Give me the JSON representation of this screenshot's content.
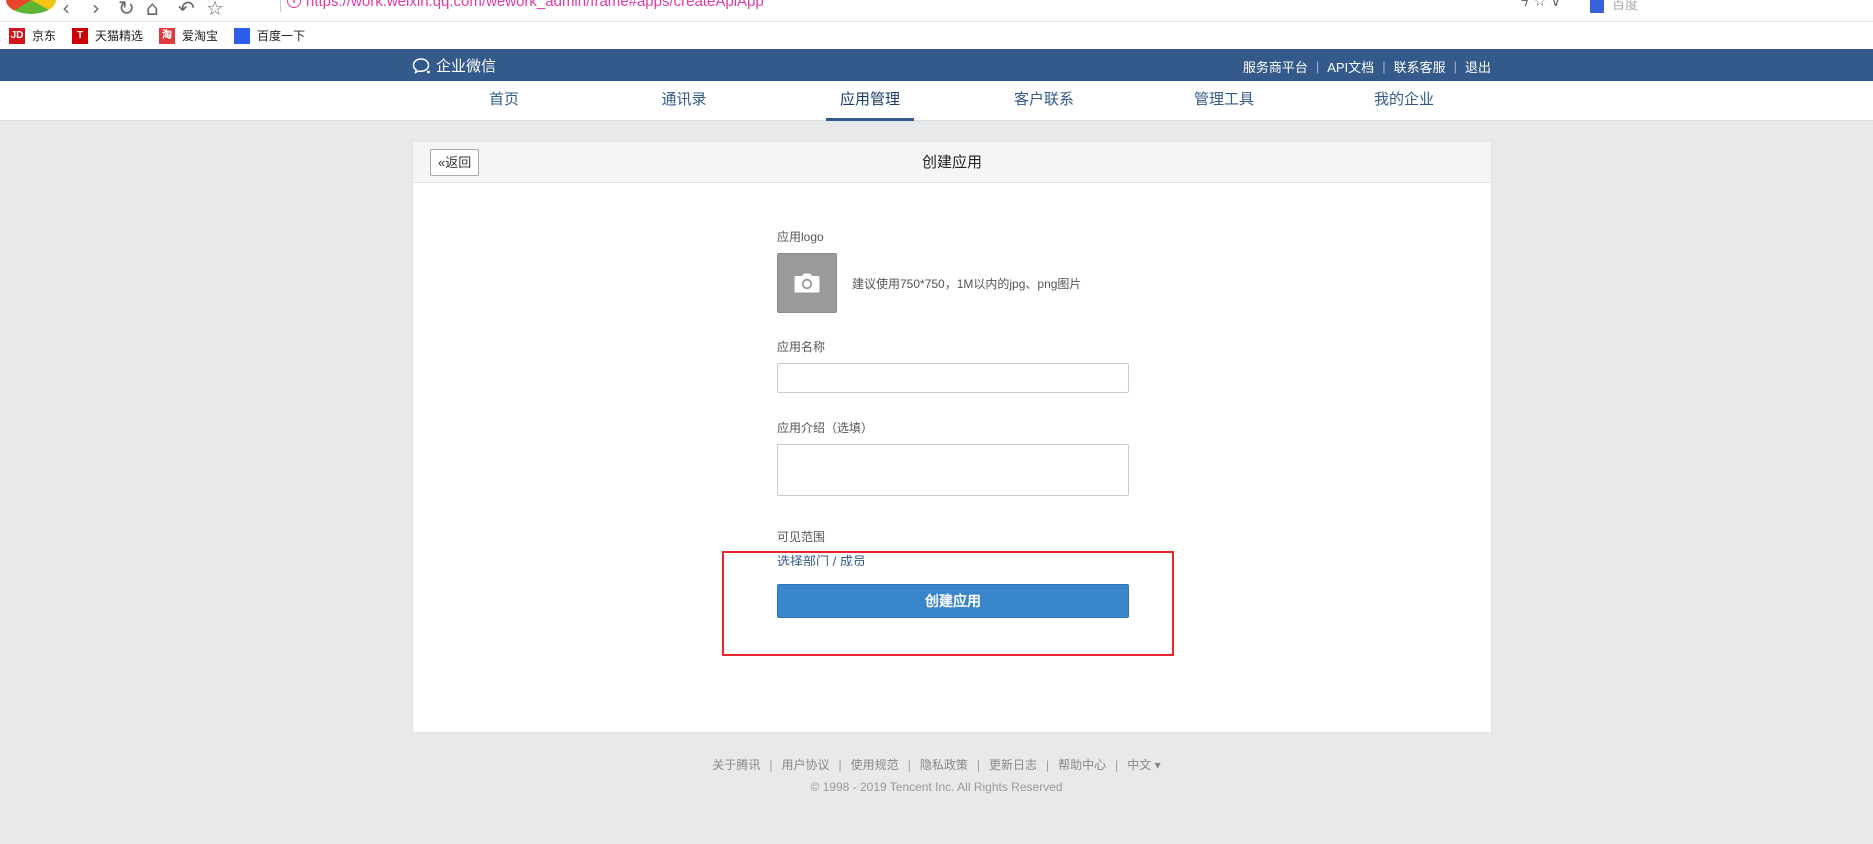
{
  "browser": {
    "url": "https://work.weixin.qq.com/wework_admin/frame#apps/createApiApp",
    "search_engine": "百度"
  },
  "bookmarks": [
    {
      "label": "京东",
      "icon": "jd-icon",
      "color": "#d7141a",
      "icon_text": "JD"
    },
    {
      "label": "天猫精选",
      "icon": "tmall-icon",
      "color": "#cc0000",
      "icon_text": "T"
    },
    {
      "label": "爱淘宝",
      "icon": "taobao-icon",
      "color": "#e4393c",
      "icon_text": "淘"
    },
    {
      "label": "百度一下",
      "icon": "baidu-icon",
      "color": "#2b5ee8",
      "icon_text": ""
    }
  ],
  "header": {
    "brand": "企业微信",
    "links": [
      "服务商平台",
      "API文档",
      "联系客服",
      "退出"
    ]
  },
  "nav": {
    "items": [
      "首页",
      "通讯录",
      "应用管理",
      "客户联系",
      "管理工具",
      "我的企业"
    ],
    "active": "应用管理"
  },
  "panel": {
    "back_label": "返回",
    "title": "创建应用"
  },
  "form": {
    "logo_label": "应用logo",
    "logo_hint": "建议使用750*750，1M以内的jpg、png图片",
    "name_label": "应用名称",
    "name_value": "",
    "intro_label": "应用介绍（选填）",
    "intro_value": "",
    "scope_label": "可见范围",
    "scope_link": "选择部门 / 成员",
    "submit_label": "创建应用"
  },
  "footer": {
    "links": [
      "关于腾讯",
      "用户协议",
      "使用规范",
      "隐私政策",
      "更新日志",
      "帮助中心",
      "中文 ▾"
    ],
    "copyright": "© 1998 - 2019 Tencent Inc. All Rights Reserved"
  },
  "colors": {
    "topbar": "#335a8a",
    "primary_button": "#3a86cd",
    "highlight": "#e8242c",
    "url": "#e23aa5"
  }
}
